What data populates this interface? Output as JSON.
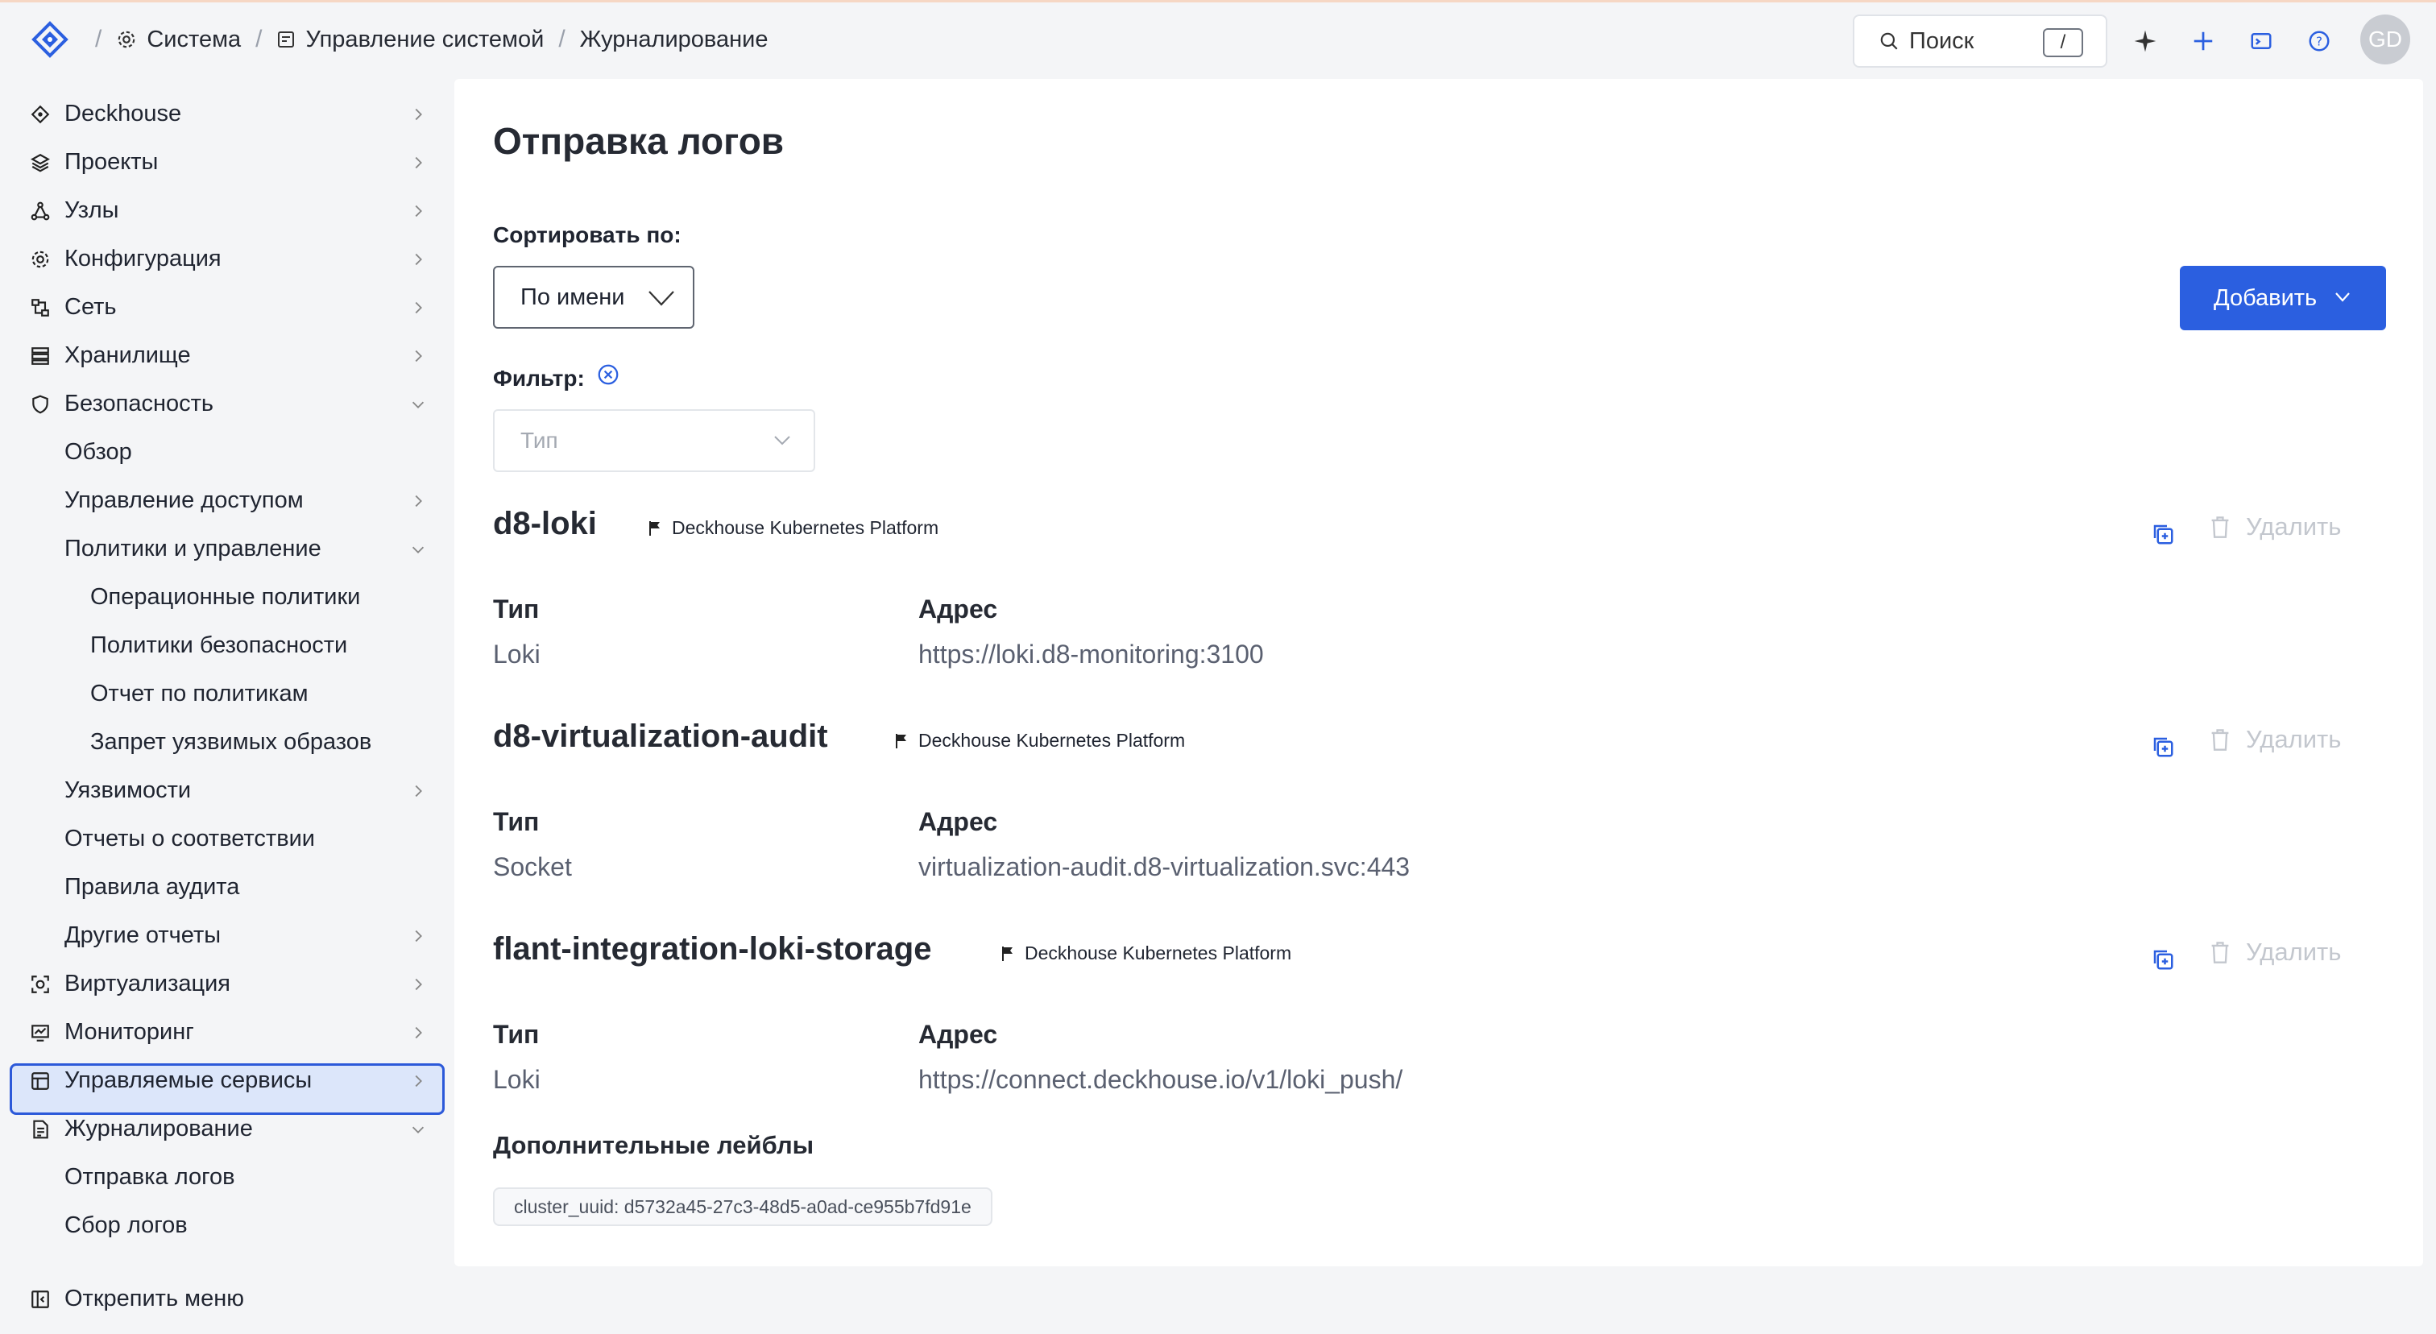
{
  "breadcrumb": {
    "items": [
      {
        "label": "Система",
        "icon": "gear-icon"
      },
      {
        "label": "Управление системой",
        "icon": "panel-icon"
      },
      {
        "label": "Журналирование",
        "icon": ""
      }
    ],
    "separator": "/"
  },
  "header": {
    "search_label": "Поиск",
    "search_shortcut": "/",
    "avatar_initials": "GD",
    "icons": [
      "sparkle-icon",
      "plus-icon",
      "terminal-icon",
      "help-icon"
    ]
  },
  "sidebar": {
    "items": [
      {
        "label": "Deckhouse",
        "icon": "deckhouse-icon",
        "level": 1,
        "chevron": "right"
      },
      {
        "label": "Проекты",
        "icon": "layers-icon",
        "level": 1,
        "chevron": "right"
      },
      {
        "label": "Узлы",
        "icon": "nodes-icon",
        "level": 1,
        "chevron": "right"
      },
      {
        "label": "Конфигурация",
        "icon": "gear-icon",
        "level": 1,
        "chevron": "right"
      },
      {
        "label": "Сеть",
        "icon": "network-icon",
        "level": 1,
        "chevron": "right"
      },
      {
        "label": "Хранилище",
        "icon": "storage-icon",
        "level": 1,
        "chevron": "right"
      },
      {
        "label": "Безопасность",
        "icon": "shield-icon",
        "level": 1,
        "chevron": "down"
      },
      {
        "label": "Обзор",
        "icon": "",
        "level": 2,
        "chevron": ""
      },
      {
        "label": "Управление доступом",
        "icon": "",
        "level": 2,
        "chevron": "right"
      },
      {
        "label": "Политики и управление",
        "icon": "",
        "level": 2,
        "chevron": "down"
      },
      {
        "label": "Операционные политики",
        "icon": "",
        "level": 3,
        "chevron": ""
      },
      {
        "label": "Политики безопасности",
        "icon": "",
        "level": 3,
        "chevron": ""
      },
      {
        "label": "Отчет по политикам",
        "icon": "",
        "level": 3,
        "chevron": ""
      },
      {
        "label": "Запрет уязвимых образов",
        "icon": "",
        "level": 3,
        "chevron": ""
      },
      {
        "label": "Уязвимости",
        "icon": "",
        "level": 2,
        "chevron": "right"
      },
      {
        "label": "Отчеты о соответствии",
        "icon": "",
        "level": 2,
        "chevron": ""
      },
      {
        "label": "Правила аудита",
        "icon": "",
        "level": 2,
        "chevron": ""
      },
      {
        "label": "Другие отчеты",
        "icon": "",
        "level": 2,
        "chevron": "right"
      },
      {
        "label": "Виртуализация",
        "icon": "virtualization-icon",
        "level": 1,
        "chevron": "right"
      },
      {
        "label": "Мониторинг",
        "icon": "monitoring-icon",
        "level": 1,
        "chevron": "right"
      },
      {
        "label": "Управляемые сервисы",
        "icon": "services-icon",
        "level": 1,
        "chevron": "right"
      },
      {
        "label": "Журналирование",
        "icon": "log-icon",
        "level": 1,
        "chevron": "down"
      },
      {
        "label": "Отправка логов",
        "icon": "",
        "level": 2,
        "chevron": "",
        "active": true
      },
      {
        "label": "Сбор логов",
        "icon": "",
        "level": 2,
        "chevron": ""
      }
    ],
    "unpin_label": "Открепить меню"
  },
  "main": {
    "title": "Отправка логов",
    "sort_label": "Сортировать по:",
    "sort_value": "По имени",
    "add_label": "Добавить",
    "filter_label": "Фильтр:",
    "type_placeholder": "Тип",
    "type_header": "Тип",
    "address_header": "Адрес",
    "delete_label": "Удалить",
    "extra_labels_title": "Дополнительные лейблы",
    "entries": [
      {
        "name": "d8-loki",
        "tag": "Deckhouse Kubernetes Platform",
        "type": "Loki",
        "address": "https://loki.d8-monitoring:3100"
      },
      {
        "name": "d8-virtualization-audit",
        "tag": "Deckhouse Kubernetes Platform",
        "type": "Socket",
        "address": "virtualization-audit.d8-virtualization.svc:443"
      },
      {
        "name": "flant-integration-loki-storage",
        "tag": "Deckhouse Kubernetes Platform",
        "type": "Loki",
        "address": "https://connect.deckhouse.io/v1/loki_push/",
        "labels": [
          "cluster_uuid: d5732a45-27c3-48d5-a0ad-ce955b7fd91e"
        ]
      }
    ]
  },
  "colors": {
    "accent": "#2b5fe0",
    "active_bg": "#dce6fa",
    "active_border": "#2c59d9"
  }
}
